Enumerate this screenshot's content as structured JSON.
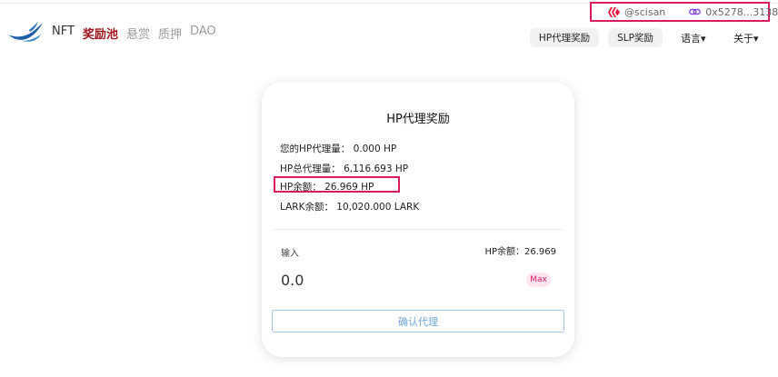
{
  "account": {
    "hive_user": "@scisan",
    "wallet_address": "0x5278...3138"
  },
  "nav": {
    "items": [
      {
        "label": "NFT",
        "style": "normal"
      },
      {
        "label": "奖励池",
        "style": "active"
      },
      {
        "label": "悬赏",
        "style": "muted"
      },
      {
        "label": "质押",
        "style": "muted"
      },
      {
        "label": "DAO",
        "style": "muted"
      }
    ]
  },
  "header": {
    "hp_reward_tab": "HP代理奖励",
    "slp_reward_tab": "SLP奖励",
    "language_menu": "语言",
    "about_menu": "关于"
  },
  "card": {
    "title": "HP代理奖励",
    "my_delegated": "您的HP代理量： 0.000 HP",
    "total_delegated": "HP总代理量： 6,116.693 HP",
    "hp_balance": "HP余额： 26.969 HP",
    "lark_balance": "LARK余额： 10,020.000 LARK",
    "input_label": "输入",
    "available_balance": "HP余额：26.969",
    "amount_value": "0.0",
    "max_label": "Max",
    "confirm_label": "确认代理"
  },
  "colors": {
    "accent": "#a0121a",
    "highlight_border": "#d81b60",
    "hive_red": "#e31337",
    "chain_purple": "#8247e5",
    "confirm_blue": "#6fa8d8",
    "logo_blue": "#1c5fa8"
  },
  "icons": {
    "hive": "hive-icon",
    "chain": "chain-link-icon",
    "logo": "bird-logo-icon",
    "caret": "caret-down-icon"
  }
}
